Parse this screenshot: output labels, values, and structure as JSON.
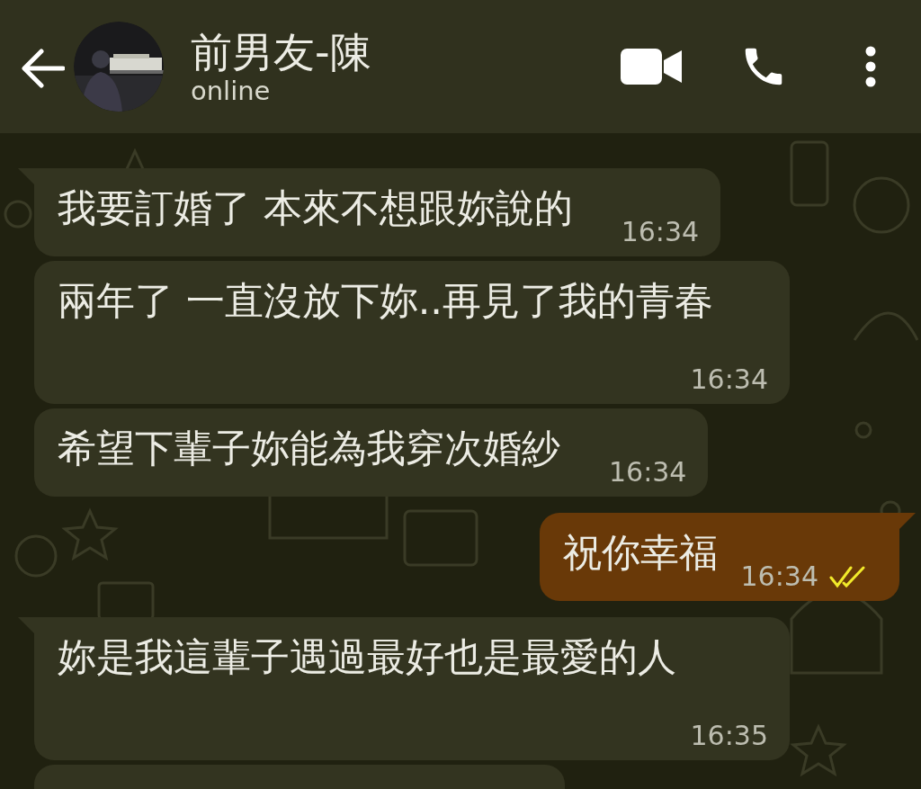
{
  "header": {
    "contact_name": "前男友-陳",
    "status": "online"
  },
  "messages": [
    {
      "kind": "incoming",
      "tail": true,
      "text": "我要訂婚了 本來不想跟妳說的",
      "time": "16:34"
    },
    {
      "kind": "incoming",
      "tail": false,
      "text": "兩年了 一直沒放下妳..再見了我的青春",
      "time": "16:34"
    },
    {
      "kind": "incoming",
      "tail": false,
      "text": "希望下輩子妳能為我穿次婚紗",
      "time": "16:34"
    },
    {
      "kind": "outgoing",
      "tail": true,
      "text": "祝你幸福",
      "time": "16:34",
      "read": true
    },
    {
      "kind": "incoming",
      "tail": true,
      "text": "妳是我這輩子遇過最好也是最愛的人",
      "time": "16:35"
    },
    {
      "kind": "incoming",
      "tail": false,
      "cut_off": true
    }
  ]
}
